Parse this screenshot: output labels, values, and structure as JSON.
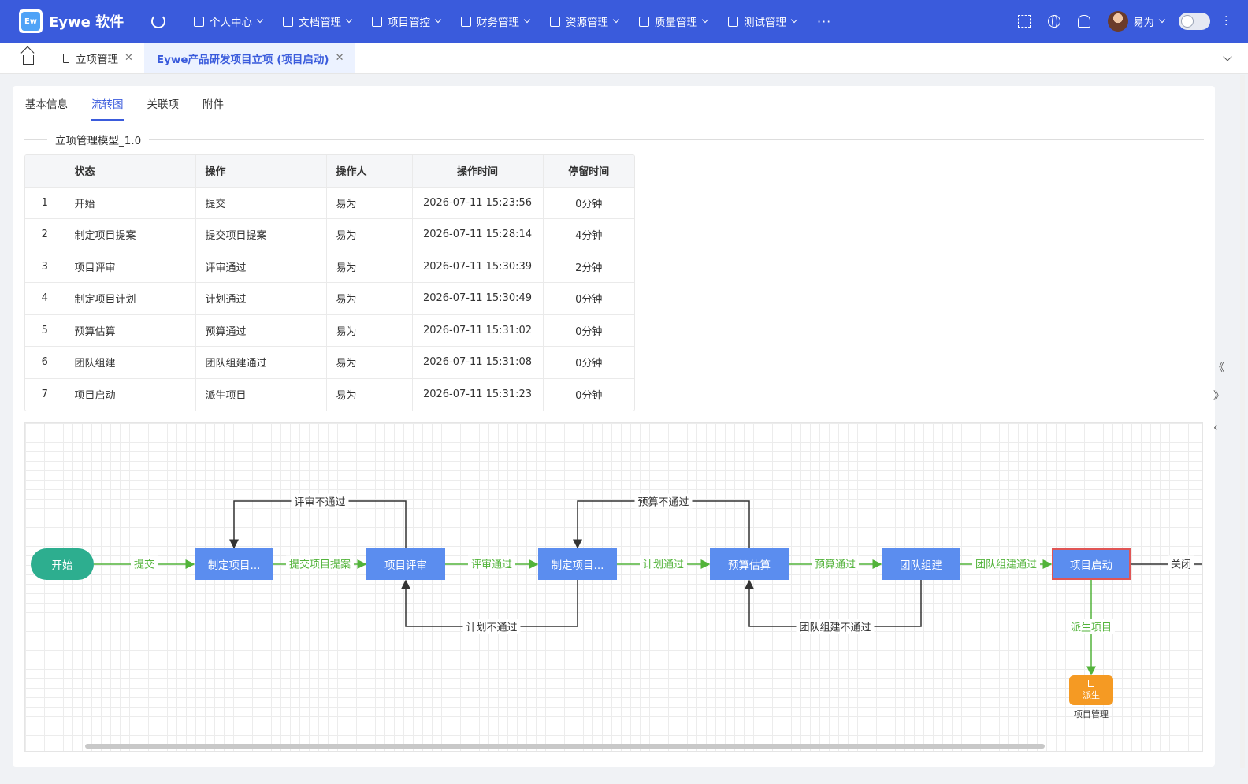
{
  "app": {
    "logo_letters": "Ew",
    "name": "Eywe 软件"
  },
  "nav": {
    "items": [
      {
        "label": "个人中心",
        "icon": "home-icon"
      },
      {
        "label": "文档管理",
        "icon": "folder-icon"
      },
      {
        "label": "项目管控",
        "icon": "flag-icon"
      },
      {
        "label": "财务管理",
        "icon": "wallet-icon"
      },
      {
        "label": "资源管理",
        "icon": "org-icon"
      },
      {
        "label": "质量管理",
        "icon": "shield-icon"
      },
      {
        "label": "测试管理",
        "icon": "calendar-icon"
      }
    ],
    "more": "···"
  },
  "user": {
    "name": "易为"
  },
  "tabs": [
    {
      "label": "立项管理"
    },
    {
      "label": "Eywe产品研发项目立项 (项目启动)"
    }
  ],
  "subtabs": [
    "基本信息",
    "流转图",
    "关联项",
    "附件"
  ],
  "model_title": "立项管理模型_1.0",
  "table": {
    "headers": [
      "",
      "状态",
      "操作",
      "操作人",
      "操作时间",
      "停留时间"
    ],
    "rows": [
      [
        "1",
        "开始",
        "提交",
        "易为",
        "2026-07-11 15:23:56",
        "0分钟"
      ],
      [
        "2",
        "制定项目提案",
        "提交项目提案",
        "易为",
        "2026-07-11 15:28:14",
        "4分钟"
      ],
      [
        "3",
        "项目评审",
        "评审通过",
        "易为",
        "2026-07-11 15:30:39",
        "2分钟"
      ],
      [
        "4",
        "制定项目计划",
        "计划通过",
        "易为",
        "2026-07-11 15:30:49",
        "0分钟"
      ],
      [
        "5",
        "预算估算",
        "预算通过",
        "易为",
        "2026-07-11 15:31:02",
        "0分钟"
      ],
      [
        "6",
        "团队组建",
        "团队组建通过",
        "易为",
        "2026-07-11 15:31:08",
        "0分钟"
      ],
      [
        "7",
        "项目启动",
        "派生项目",
        "易为",
        "2026-07-11 15:31:23",
        "0分钟"
      ]
    ]
  },
  "flow": {
    "start": "开始",
    "nodes": [
      "制定项目...",
      "项目评审",
      "制定项目...",
      "预算估算",
      "团队组建",
      "项目启动"
    ],
    "forward_labels": [
      "提交",
      "提交项目提案",
      "评审通过",
      "计划通过",
      "预算通过",
      "团队组建通过"
    ],
    "reject_labels": {
      "review": "评审不通过",
      "plan": "计划不通过",
      "budget": "预算不通过",
      "team": "团队组建不通过"
    },
    "close_label": "关闭",
    "spawn_label": "派生项目",
    "spawn_node": "派生",
    "spawn_sub": "项目管理",
    "colors": {
      "node": "#5b8def",
      "start": "#2dae8f",
      "forward": "#52b33a",
      "reject": "#333333",
      "spawn": "#f59a23",
      "selected_border": "#e05555"
    }
  },
  "colors": {
    "primary": "#3a5bdc"
  }
}
